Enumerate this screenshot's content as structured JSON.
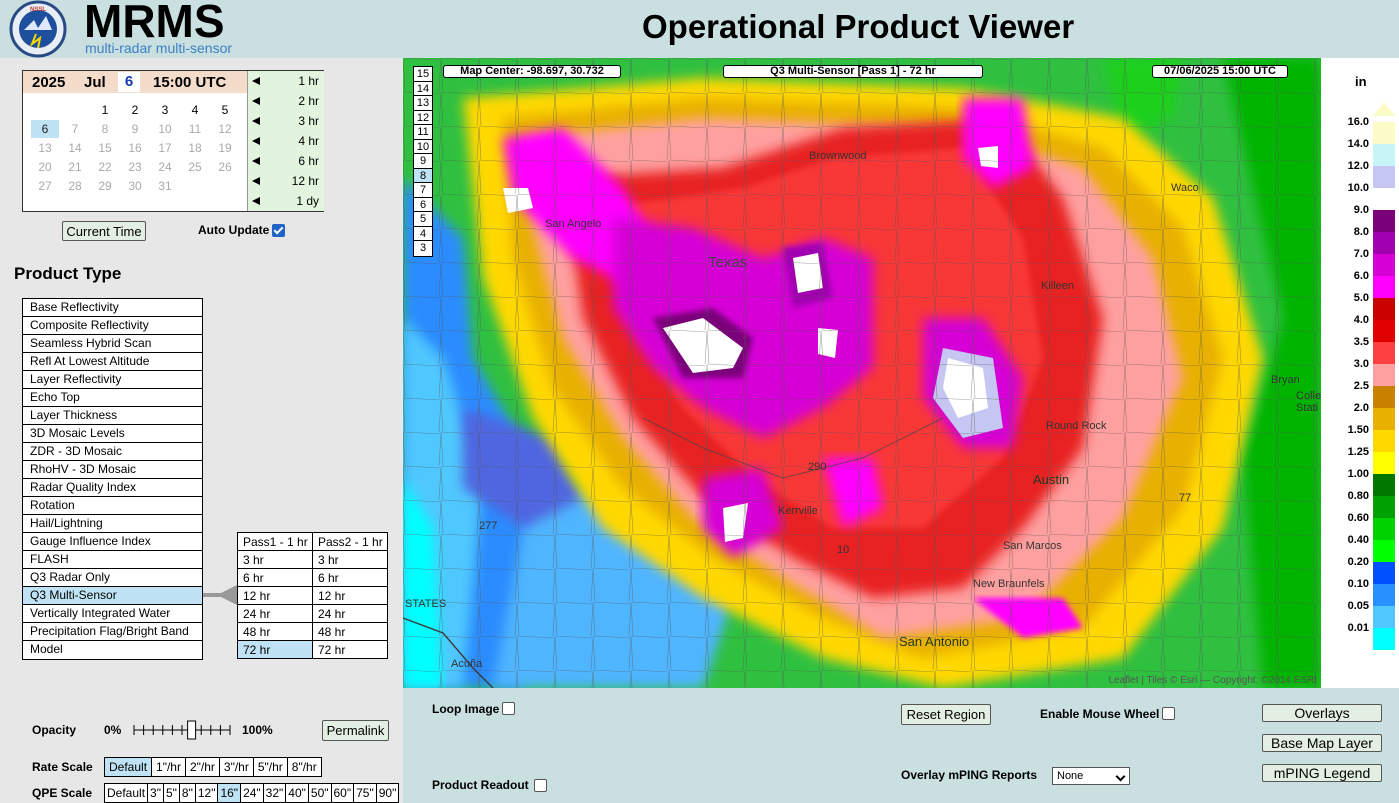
{
  "header": {
    "logo_text": "NSSL",
    "brand": "MRMS",
    "brand_sub": "multi-radar multi-sensor",
    "title": "Operational Product Viewer"
  },
  "date": {
    "year": "2025",
    "month": "Jul",
    "day": "6",
    "time": "15:00 UTC",
    "calendar": [
      {
        "d": "1",
        "c": 3,
        "r": 0,
        "s": "on"
      },
      {
        "d": "2",
        "c": 4,
        "r": 0,
        "s": "on"
      },
      {
        "d": "3",
        "c": 5,
        "r": 0,
        "s": "on"
      },
      {
        "d": "4",
        "c": 6,
        "r": 0,
        "s": "on"
      },
      {
        "d": "5",
        "c": 7,
        "r": 0,
        "s": "on"
      },
      {
        "d": "6",
        "c": 1,
        "r": 1,
        "s": "sel"
      },
      {
        "d": "7",
        "c": 2,
        "r": 1,
        "s": "off"
      },
      {
        "d": "8",
        "c": 3,
        "r": 1,
        "s": "off"
      },
      {
        "d": "9",
        "c": 4,
        "r": 1,
        "s": "off"
      },
      {
        "d": "10",
        "c": 5,
        "r": 1,
        "s": "off"
      },
      {
        "d": "11",
        "c": 6,
        "r": 1,
        "s": "off"
      },
      {
        "d": "12",
        "c": 7,
        "r": 1,
        "s": "off"
      },
      {
        "d": "13",
        "c": 1,
        "r": 2,
        "s": "off"
      },
      {
        "d": "14",
        "c": 2,
        "r": 2,
        "s": "off"
      },
      {
        "d": "15",
        "c": 3,
        "r": 2,
        "s": "off"
      },
      {
        "d": "16",
        "c": 4,
        "r": 2,
        "s": "off"
      },
      {
        "d": "17",
        "c": 5,
        "r": 2,
        "s": "off"
      },
      {
        "d": "18",
        "c": 6,
        "r": 2,
        "s": "off"
      },
      {
        "d": "19",
        "c": 7,
        "r": 2,
        "s": "off"
      },
      {
        "d": "20",
        "c": 1,
        "r": 3,
        "s": "off"
      },
      {
        "d": "21",
        "c": 2,
        "r": 3,
        "s": "off"
      },
      {
        "d": "22",
        "c": 3,
        "r": 3,
        "s": "off"
      },
      {
        "d": "23",
        "c": 4,
        "r": 3,
        "s": "off"
      },
      {
        "d": "24",
        "c": 5,
        "r": 3,
        "s": "off"
      },
      {
        "d": "25",
        "c": 6,
        "r": 3,
        "s": "off"
      },
      {
        "d": "26",
        "c": 7,
        "r": 3,
        "s": "off"
      },
      {
        "d": "27",
        "c": 1,
        "r": 4,
        "s": "off"
      },
      {
        "d": "28",
        "c": 2,
        "r": 4,
        "s": "off"
      },
      {
        "d": "29",
        "c": 3,
        "r": 4,
        "s": "off"
      },
      {
        "d": "30",
        "c": 4,
        "r": 4,
        "s": "off"
      },
      {
        "d": "31",
        "c": 5,
        "r": 4,
        "s": "off"
      }
    ],
    "intervals": [
      "1 hr",
      "2 hr",
      "3 hr",
      "4 hr",
      "6 hr",
      "12 hr",
      "1 dy"
    ]
  },
  "controls": {
    "current_time": "Current Time",
    "auto_update": "Auto Update"
  },
  "product_type": {
    "title": "Product Type",
    "items": [
      "Base Reflectivity",
      "Composite Reflectivity",
      "Seamless Hybrid Scan",
      "Refl At Lowest Altitude",
      "Layer Reflectivity",
      "Echo Top",
      "Layer Thickness",
      "3D Mosaic Levels",
      "ZDR - 3D Mosaic",
      "RhoHV - 3D Mosaic",
      "Radar Quality Index",
      "Rotation",
      "Hail/Lightning",
      "Gauge Influence Index",
      "FLASH",
      "Q3 Radar Only",
      "Q3 Multi-Sensor",
      "Vertically Integrated Water",
      "Precipitation Flag/Bright Band",
      "Model"
    ],
    "selected": "Q3 Multi-Sensor"
  },
  "pass_table": {
    "rows": [
      [
        "Pass1 - 1 hr",
        "Pass2 - 1 hr"
      ],
      [
        "3 hr",
        "3 hr"
      ],
      [
        "6 hr",
        "6 hr"
      ],
      [
        "12 hr",
        "12 hr"
      ],
      [
        "24 hr",
        "24 hr"
      ],
      [
        "48 hr",
        "48 hr"
      ],
      [
        "72 hr",
        "72 hr"
      ]
    ],
    "selected": "72 hr"
  },
  "opacity": {
    "label": "Opacity",
    "min": "0%",
    "max": "100%",
    "value_percent": 60
  },
  "permalink": "Permalink",
  "rate_scale": {
    "label": "Rate Scale",
    "options": [
      "Default",
      "1\"/hr",
      "2\"/hr",
      "3\"/hr",
      "5\"/hr",
      "8\"/hr"
    ],
    "selected": "Default"
  },
  "qpe_scale": {
    "label": "QPE Scale",
    "options": [
      "Default",
      "3\"",
      "5\"",
      "8\"",
      "12\"",
      "16\"",
      "24\"",
      "32\"",
      "40\"",
      "50\"",
      "60\"",
      "75\"",
      "90\""
    ],
    "selected": "16\""
  },
  "map": {
    "center": "Map Center: -98.697, 30.732",
    "product": "Q3 Multi-Sensor [Pass 1] - 72 hr",
    "valid": "07/06/2025  15:00 UTC",
    "zoom_levels": [
      "15",
      "14",
      "13",
      "12",
      "11",
      "10",
      "9",
      "8",
      "7",
      "6",
      "5",
      "4",
      "3"
    ],
    "zoom_selected": "8",
    "attribution": "Leaflet | Tiles © Esri — Copyright: ©2014 ESRI",
    "places": {
      "brownwood": "Brownwood",
      "san_angelo": "San Angelo",
      "texas": "Texas",
      "killeen": "Killeen",
      "waco": "Waco",
      "round_rock": "Round Rock",
      "austin": "Austin",
      "kerrville": "Kerrville",
      "san_marcos": "San Marcos",
      "new_braunfels": "New Braunfels",
      "san_antonio": "San Antonio",
      "acuna": "Acuña",
      "bryan": "Bryan",
      "college_station_a": "Colle",
      "college_station_b": "Stati",
      "road_290": "290",
      "road_10": "10",
      "road_277": "277",
      "road_77": "77",
      "states": "STATES"
    }
  },
  "legend": {
    "unit": "in",
    "entries": [
      {
        "label": "16.0",
        "color": "#fbfbc8"
      },
      {
        "label": "14.0",
        "color": "#c7f4f7"
      },
      {
        "label": "12.0",
        "color": "#c6c6f2"
      },
      {
        "label": "10.0",
        "color": "#ffffff"
      },
      {
        "label": "9.0",
        "color": "#7a007a"
      },
      {
        "label": "8.0",
        "color": "#a000b0"
      },
      {
        "label": "7.0",
        "color": "#d600d6"
      },
      {
        "label": "6.0",
        "color": "#ff00ff"
      },
      {
        "label": "5.0",
        "color": "#c80000"
      },
      {
        "label": "4.0",
        "color": "#e00000"
      },
      {
        "label": "3.5",
        "color": "#ff4040"
      },
      {
        "label": "3.0",
        "color": "#ffa0a0"
      },
      {
        "label": "2.5",
        "color": "#c88000"
      },
      {
        "label": "2.0",
        "color": "#e8b000"
      },
      {
        "label": "1.50",
        "color": "#ffd800"
      },
      {
        "label": "1.25",
        "color": "#ffff00"
      },
      {
        "label": "1.00",
        "color": "#007800"
      },
      {
        "label": "0.80",
        "color": "#00a000"
      },
      {
        "label": "0.60",
        "color": "#00d200"
      },
      {
        "label": "0.40",
        "color": "#00ff00"
      },
      {
        "label": "0.20",
        "color": "#0050ff"
      },
      {
        "label": "0.10",
        "color": "#2890ff"
      },
      {
        "label": "0.05",
        "color": "#50c8ff"
      },
      {
        "label": "0.01",
        "color": "#00ffff"
      }
    ]
  },
  "bottom": {
    "loop_image": "Loop Image",
    "product_readout": "Product Readout",
    "reset_region": "Reset Region",
    "enable_mouse_wheel": "Enable Mouse Wheel",
    "overlay_mping": "Overlay mPING Reports",
    "mping_select": "None",
    "overlays": "Overlays",
    "base_map_layer": "Base Map Layer",
    "mping_legend": "mPING Legend"
  }
}
